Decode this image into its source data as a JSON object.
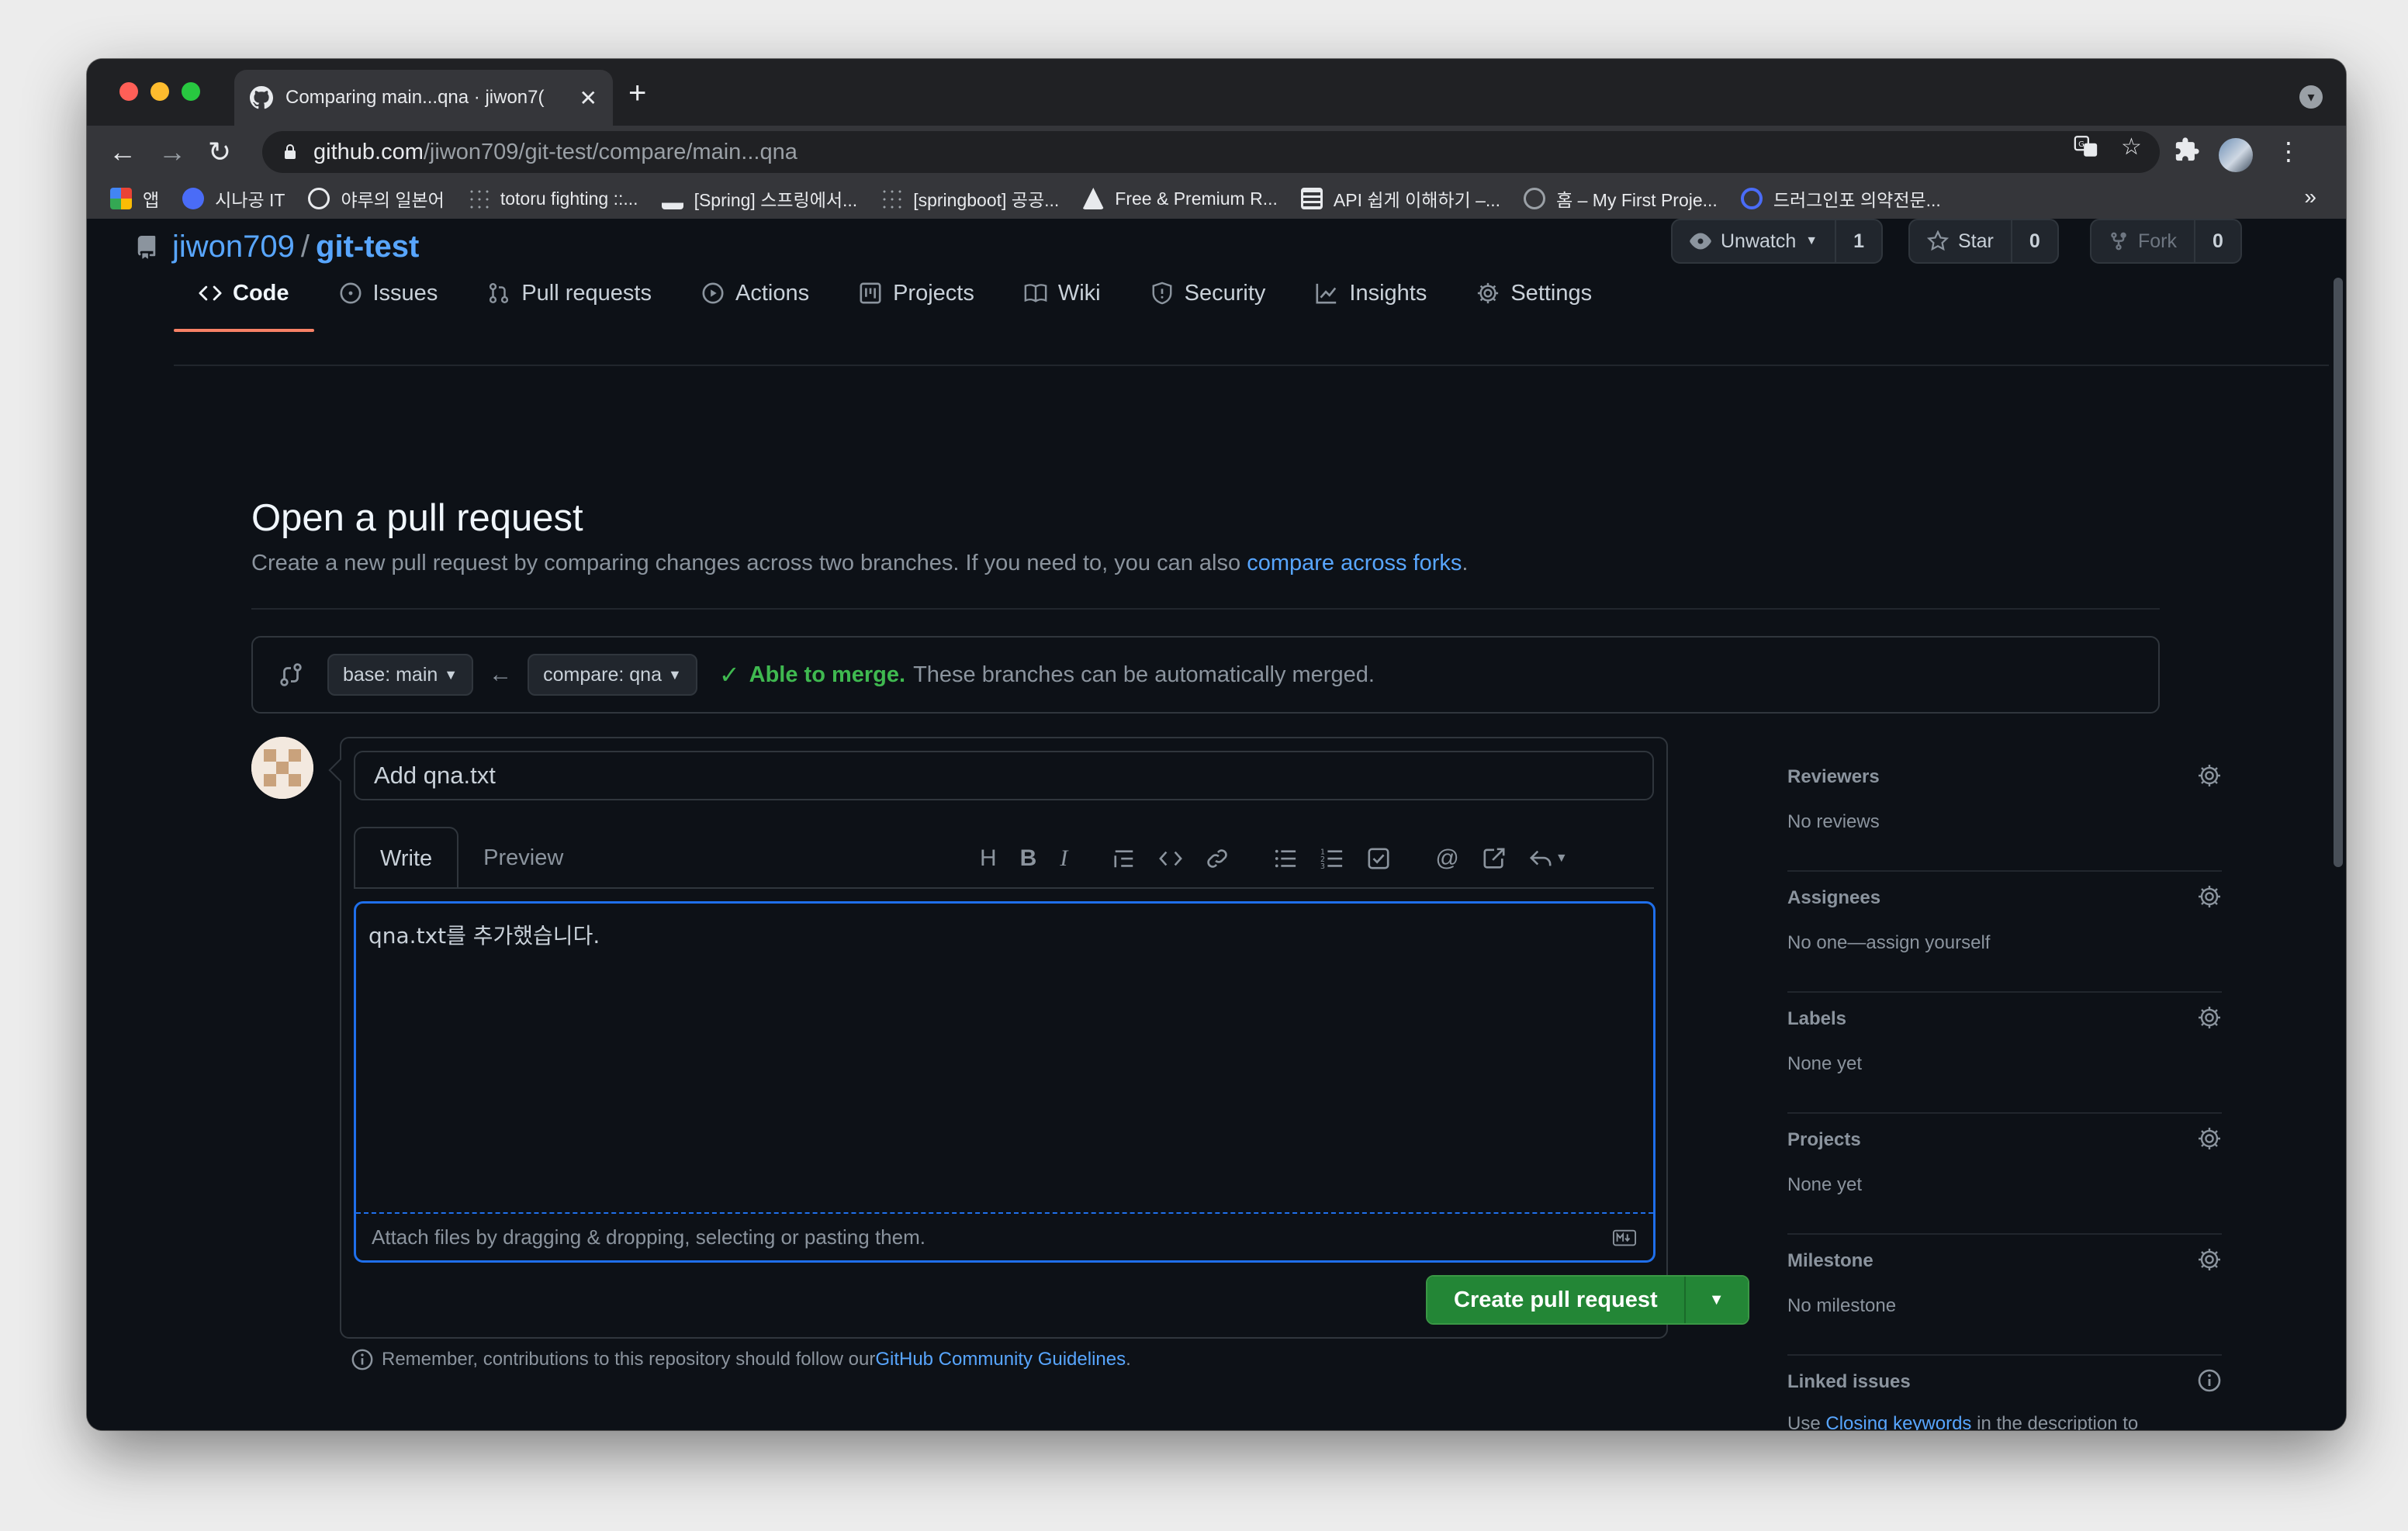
{
  "browser": {
    "tab_title": "Comparing main...qna · jiwon7(",
    "new_tab": "+",
    "close_tab": "✕",
    "url_host": "github.com",
    "url_path": "/jiwon709/git-test/compare/main...qna",
    "bookmarks": [
      {
        "label": "앱",
        "color": "#ea4335"
      },
      {
        "label": "시나공 IT",
        "color": "#4a6cf7"
      },
      {
        "label": "야루의 일본어",
        "color": "#e8eaed"
      },
      {
        "label": "totoru fighting ::...",
        "color": "#9aa0a6"
      },
      {
        "label": "[Spring] 스프링에서...",
        "color": "#9aa0a6"
      },
      {
        "label": "[springboot] 공공...",
        "color": "#9aa0a6"
      },
      {
        "label": "Free & Premium R...",
        "color": "#e8eaed"
      },
      {
        "label": "API 쉽게 이해하기 –...",
        "color": "#e8eaed"
      },
      {
        "label": "홈 – My First Proje...",
        "color": "#9aa0a6"
      },
      {
        "label": "드러그인포 의약전문...",
        "color": "#4a6cf7"
      }
    ],
    "bookmarks_more": "»"
  },
  "repo": {
    "owner": "jiwon709",
    "separator": "/",
    "name": "git-test",
    "unwatch_label": "Unwatch",
    "unwatch_count": "1",
    "star_label": "Star",
    "star_count": "0",
    "fork_label": "Fork",
    "fork_count": "0"
  },
  "nav": {
    "code": "Code",
    "issues": "Issues",
    "pull_requests": "Pull requests",
    "actions": "Actions",
    "projects": "Projects",
    "wiki": "Wiki",
    "security": "Security",
    "insights": "Insights",
    "settings": "Settings"
  },
  "compare": {
    "heading": "Open a pull request",
    "subtitle_prefix": "Create a new pull request by comparing changes across two branches. If you need to, you can also ",
    "subtitle_link": "compare across forks",
    "subtitle_suffix": ".",
    "base_branch": "base: main",
    "compare_branch": "compare: qna",
    "merge_ok": "Able to merge.",
    "merge_msg": "These branches can be automatically merged."
  },
  "form": {
    "title_value": "Add qna.txt",
    "tab_write": "Write",
    "tab_preview": "Preview",
    "body_value": "qna.txt를 추가했습니다.",
    "attach_hint": "Attach files by dragging & dropping, selecting or pasting them.",
    "submit": "Create pull request"
  },
  "footer_note": {
    "prefix": "Remember, contributions to this repository should follow our ",
    "link": "GitHub Community Guidelines",
    "suffix": "."
  },
  "sidebar": {
    "reviewers": {
      "title": "Reviewers",
      "value": "No reviews"
    },
    "assignees": {
      "title": "Assignees",
      "value": "No one—assign yourself"
    },
    "labels": {
      "title": "Labels",
      "value": "None yet"
    },
    "projects": {
      "title": "Projects",
      "value": "None yet"
    },
    "milestone": {
      "title": "Milestone",
      "value": "No milestone"
    },
    "linked_issues": {
      "title": "Linked issues",
      "prefix": "Use ",
      "link": "Closing keywords",
      "suffix": " in the description to automatically close issues"
    }
  }
}
